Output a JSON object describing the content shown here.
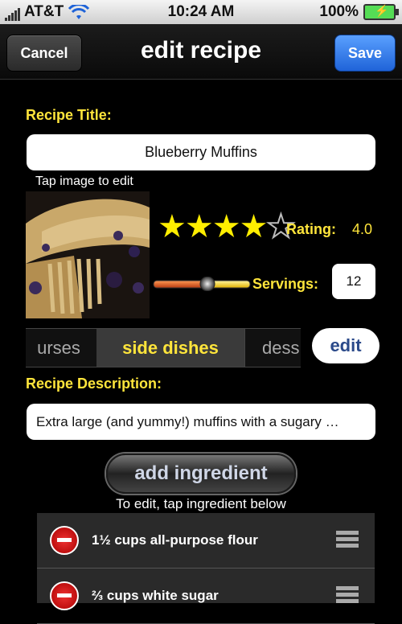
{
  "status": {
    "carrier": "AT&T",
    "time": "10:24 AM",
    "battery": "100%"
  },
  "nav": {
    "cancel": "Cancel",
    "title": "edit recipe",
    "save": "Save"
  },
  "form": {
    "title_label": "Recipe Title:",
    "title_value": "Blueberry Muffins",
    "tap_image": "Tap image to edit",
    "rating_label": "Rating:",
    "rating_value": "4.0",
    "rating_stars": 4,
    "servings_label": "Servings:",
    "servings_value": "12",
    "description_label": "Recipe Description:",
    "description_value": "Extra large (and yummy!) muffins with a sugary …"
  },
  "categories": {
    "items": [
      "urses",
      "side dishes",
      "dess"
    ],
    "selected": "side dishes",
    "edit": "edit"
  },
  "ingredients": {
    "add_button": "add ingredient",
    "hint": "To edit, tap ingredient below",
    "items": [
      "1½ cups all-purpose flour",
      "⅔ cups white sugar"
    ]
  },
  "colors": {
    "label": "#ffe53b",
    "save": "#1f63d8",
    "star": "#ffee00",
    "delete": "#cc1111"
  }
}
